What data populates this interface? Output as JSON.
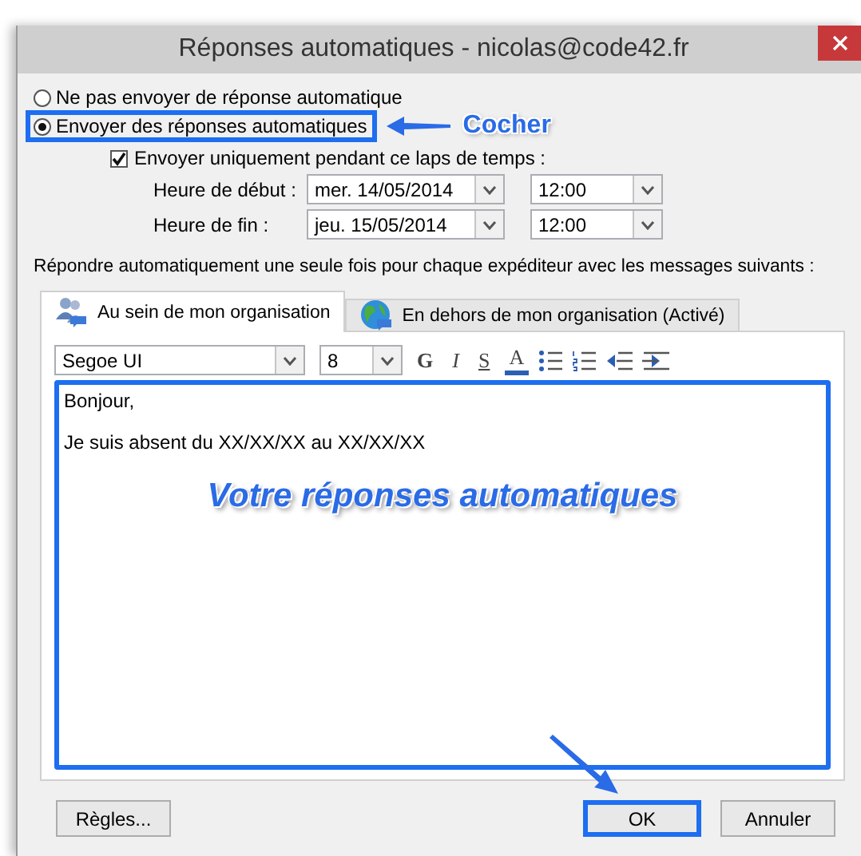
{
  "window": {
    "title": "Réponses automatiques - nicolas@code42.fr"
  },
  "reply_options": [
    {
      "label": "Ne pas envoyer de réponse automatique",
      "selected": false,
      "highlighted": false
    },
    {
      "label": "Envoyer des réponses automatiques",
      "selected": true,
      "highlighted": true
    }
  ],
  "callout": "Cocher",
  "time_range": {
    "label": "Envoyer uniquement pendant ce laps de temps :",
    "checked": true,
    "rows": [
      {
        "label": "Heure de début :",
        "date": "mer. 14/05/2014",
        "time": "12:00"
      },
      {
        "label": "Heure de fin :",
        "date": "jeu. 15/05/2014",
        "time": "12:00"
      }
    ]
  },
  "instruction": "Répondre automatiquement une seule fois pour chaque expéditeur avec les messages suivants :",
  "tabs": [
    {
      "label": "Au sein de mon organisation",
      "kind": "people",
      "selected": true
    },
    {
      "label": "En dehors de mon organisation (Activé)",
      "kind": "globe",
      "selected": false
    }
  ],
  "toolbar": {
    "font": "Segoe UI",
    "size": "8",
    "buttons": [
      {
        "kind": "bold",
        "label": "G"
      },
      {
        "kind": "italic",
        "label": "I"
      },
      {
        "kind": "underline",
        "label": "S"
      },
      {
        "kind": "color",
        "label": "A"
      }
    ]
  },
  "message": [
    "Bonjour,",
    "Je suis absent du XX/XX/XX au XX/XX/XX"
  ],
  "caption": "Votre réponses automatiques",
  "buttons": [
    {
      "label": "Règles...",
      "highlighted": false
    },
    {
      "label": "OK",
      "highlighted": true
    },
    {
      "label": "Annuler",
      "highlighted": false
    }
  ]
}
